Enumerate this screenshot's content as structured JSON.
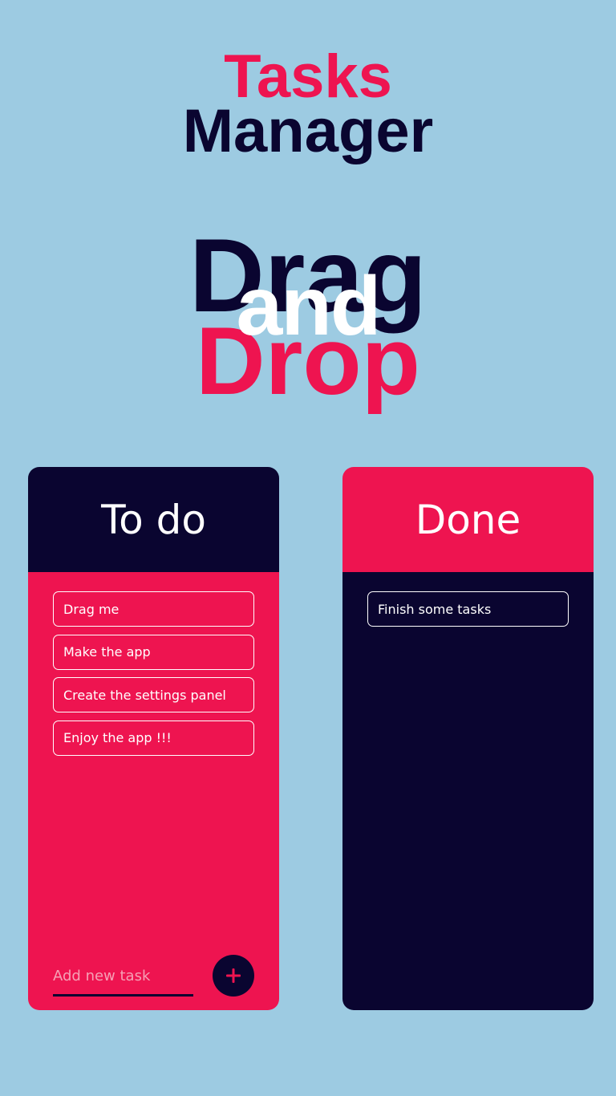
{
  "colors": {
    "background": "#9dcbe2",
    "accent": "#ee1450",
    "navy": "#0a0530",
    "white": "#ffffff"
  },
  "title": {
    "line1": "Tasks",
    "line2": "Manager"
  },
  "hero": {
    "word1": "Drag",
    "word2": "and",
    "word3": "Drop"
  },
  "todo": {
    "title": "To do",
    "tasks": [
      "Drag me",
      "Make the app",
      "Create the settings panel",
      "Enjoy the app !!!"
    ],
    "input_placeholder": "Add new task",
    "add_icon": "plus-icon"
  },
  "done": {
    "title": "Done",
    "tasks": [
      "Finish some tasks"
    ]
  }
}
